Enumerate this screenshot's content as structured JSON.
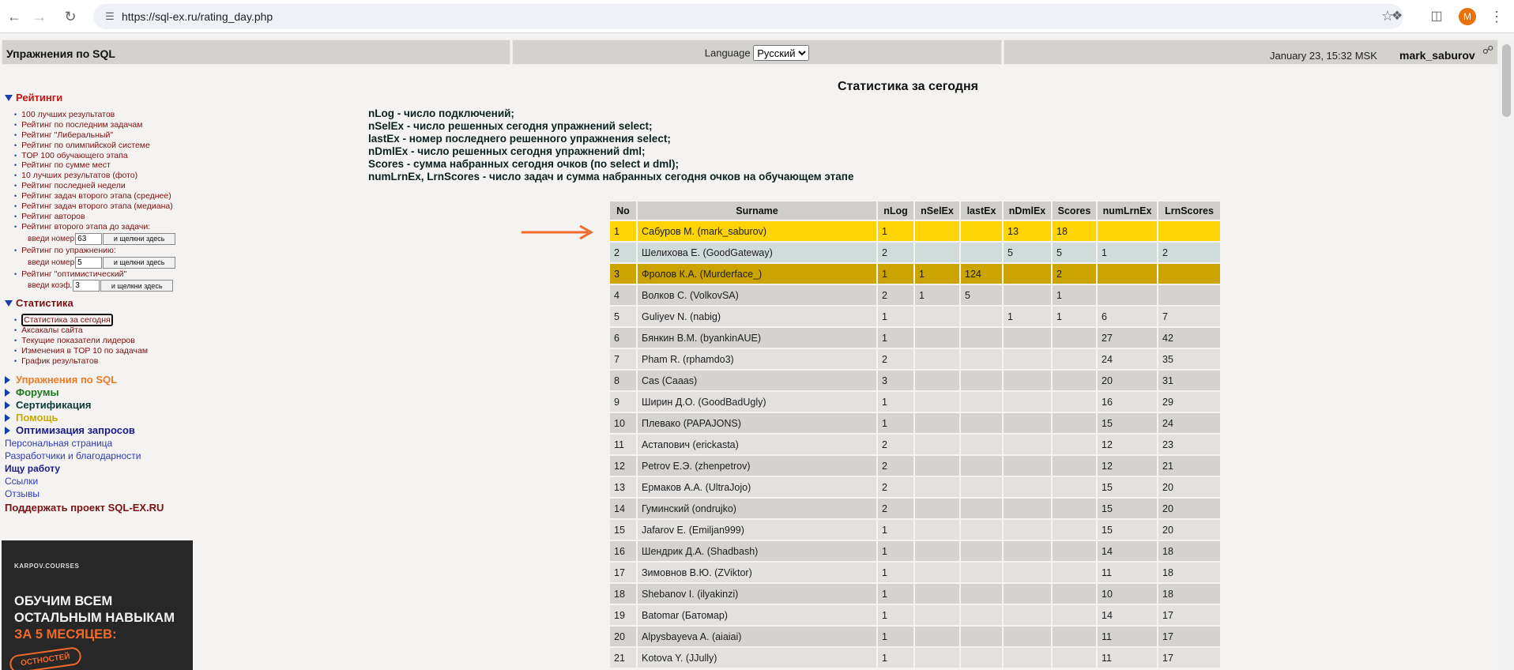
{
  "browser": {
    "url": "https://sql-ex.ru/rating_day.php",
    "avatar_letter": "M"
  },
  "header": {
    "site_title": "Упражнения по SQL",
    "language_label": "Language",
    "language_selected": "Русский",
    "datetime": "January 23, 15:32 MSK",
    "username": "mark_saburov"
  },
  "sidebar": {
    "ratings": {
      "title": "Рейтинги",
      "items": [
        "100 лучших результатов",
        "Рейтинг по последним задачам",
        "Рейтинг \"Либеральный\"",
        "Рейтинг по олимпийской системе",
        "TOP 100 обучающего этапа",
        "Рейтинг по сумме мест",
        "10 лучших результатов (фото)",
        "Рейтинг последней недели",
        "Рейтинг задач второго этапа (среднее)",
        "Рейтинг задач второго этапа (медиана)",
        "Рейтинг авторов",
        "Рейтинг второго этапа до задачи:"
      ],
      "input1": {
        "label": "введи номер",
        "value": "63",
        "button": "и щелкни здесь"
      },
      "item_exercise": "Рейтинг по упражнению:",
      "input2": {
        "label": "введи номер",
        "value": "5",
        "button": "и щелкни здесь"
      },
      "item_optimistic": "Рейтинг \"оптимистический\"",
      "input3": {
        "label": "введи коэф.",
        "value": "3",
        "button": "и щелкни здесь"
      }
    },
    "stats": {
      "title": "Статистика",
      "items": [
        "Статистика за сегодня",
        "Аксакалы сайта",
        "Текущие показатели лидеров",
        "Изменения в TOP 10 по задачам",
        "График результатов"
      ]
    },
    "collapsed": [
      {
        "label": "Упражнения по SQL",
        "color": "#f07a22"
      },
      {
        "label": "Форумы",
        "color": "#1a7a1a"
      },
      {
        "label": "Сертификация",
        "color": "#0c3a3a"
      },
      {
        "label": "Помощь",
        "color": "#c8a800"
      },
      {
        "label": "Оптимизация запросов",
        "color": "#1a1a8a"
      }
    ],
    "links": [
      "Персональная страница",
      "Разработчики и благодарности",
      "Ищу работу",
      "Ссылки",
      "Отзывы",
      "Поддержать проект SQL-EX.RU"
    ],
    "banner": {
      "brand": "KARPOV.COURSES",
      "line1": "ОБУЧИМ ВСЕМ",
      "line2": "ОСТАЛЬНЫМ НАВЫКАМ",
      "line3": "ЗА 5 МЕСЯЦЕВ:",
      "badge": "ОСТНОСТЕЙ"
    }
  },
  "main": {
    "title": "Статистика за сегодня",
    "legend": [
      "nLog - число подключений;",
      "nSelEx - число решенных сегодня упражнений select;",
      "lastEx - номер последнего решенного упражнения select;",
      "nDmlEx - число решенных сегодня упражнений dml;",
      "Scores - сумма набранных сегодня очков (по select и dml);",
      "numLrnEx, LrnScores - число задач и сумма набранных сегодня очков на обучающем этапе"
    ],
    "table": {
      "headers": [
        "No",
        "Surname",
        "nLog",
        "nSelEx",
        "lastEx",
        "nDmlEx",
        "Scores",
        "numLrnEx",
        "LrnScores"
      ],
      "rows": [
        [
          "1",
          "Сабуров М. (mark_saburov)",
          "1",
          "",
          "",
          "13",
          "18",
          "",
          ""
        ],
        [
          "2",
          "Шелихова Е. (GoodGateway)",
          "2",
          "",
          "",
          "5",
          "5",
          "1",
          "2"
        ],
        [
          "3",
          "Фролов К.А. (Murderface_)",
          "1",
          "1",
          "124",
          "",
          "2",
          "",
          ""
        ],
        [
          "4",
          "Волков С. (VolkovSA)",
          "2",
          "1",
          "5",
          "",
          "1",
          "",
          ""
        ],
        [
          "5",
          "Guliyev N. (nabig)",
          "1",
          "",
          "",
          "1",
          "1",
          "6",
          "7"
        ],
        [
          "6",
          "Бянкин В.М. (byankinAUE)",
          "1",
          "",
          "",
          "",
          "",
          "27",
          "42"
        ],
        [
          "7",
          "Pham R. (rphamdo3)",
          "2",
          "",
          "",
          "",
          "",
          "24",
          "35"
        ],
        [
          "8",
          "Cas (Caaas)",
          "3",
          "",
          "",
          "",
          "",
          "20",
          "31"
        ],
        [
          "9",
          "Ширин Д.О. (GoodBadUgly)",
          "1",
          "",
          "",
          "",
          "",
          "16",
          "29"
        ],
        [
          "10",
          "Плевако (PAPAJONS)",
          "1",
          "",
          "",
          "",
          "",
          "15",
          "24"
        ],
        [
          "11",
          "Астапович (erickasta)",
          "2",
          "",
          "",
          "",
          "",
          "12",
          "23"
        ],
        [
          "12",
          "Petrov Е.Э. (zhenpetrov)",
          "2",
          "",
          "",
          "",
          "",
          "12",
          "21"
        ],
        [
          "13",
          "Ермаков А.А. (UltraJojo)",
          "2",
          "",
          "",
          "",
          "",
          "15",
          "20"
        ],
        [
          "14",
          "Гуминский (ondrujko)",
          "2",
          "",
          "",
          "",
          "",
          "15",
          "20"
        ],
        [
          "15",
          "Jafarov E. (Emiljan999)",
          "1",
          "",
          "",
          "",
          "",
          "15",
          "20"
        ],
        [
          "16",
          "Шендрик Д.А. (Shadbash)",
          "1",
          "",
          "",
          "",
          "",
          "14",
          "18"
        ],
        [
          "17",
          "Зимовнов В.Ю. (ZViktor)",
          "1",
          "",
          "",
          "",
          "",
          "11",
          "18"
        ],
        [
          "18",
          "Shebanov I. (ilyakinzi)",
          "1",
          "",
          "",
          "",
          "",
          "10",
          "18"
        ],
        [
          "19",
          "Batomar (Батомар)",
          "1",
          "",
          "",
          "",
          "",
          "14",
          "17"
        ],
        [
          "20",
          "Alpysbayeva A. (aiaiai)",
          "1",
          "",
          "",
          "",
          "",
          "11",
          "17"
        ],
        [
          "21",
          "Kotova Y. (JJully)",
          "1",
          "",
          "",
          "",
          "",
          "11",
          "17"
        ]
      ]
    },
    "colors": {
      "rank1": "#fed406",
      "rank2": "#cfdcda",
      "rank3": "#cca400",
      "arrow": "#f06a2a"
    }
  }
}
